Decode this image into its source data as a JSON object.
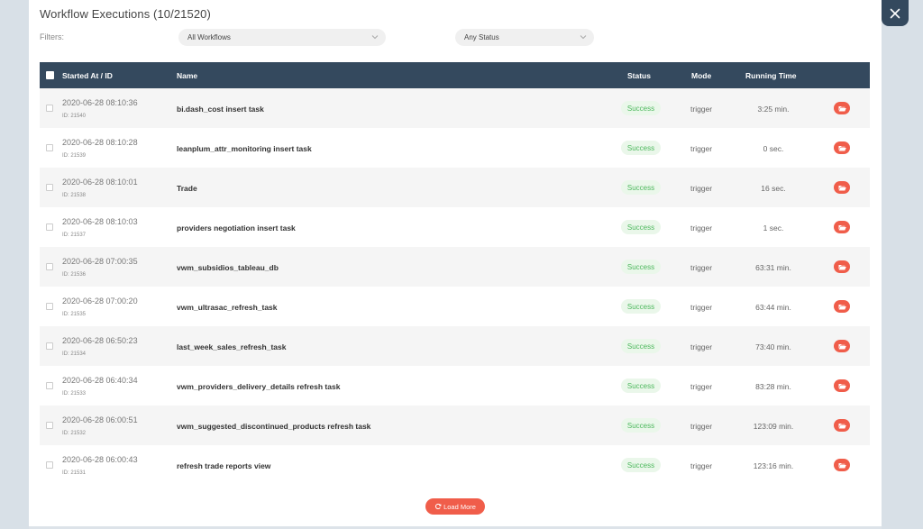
{
  "header": {
    "title": "Workflow Executions (10/21520)"
  },
  "filters": {
    "label": "Filters:",
    "workflow_selected": "All Workflows",
    "status_selected": "Any Status"
  },
  "table": {
    "columns": {
      "started": "Started At / ID",
      "name": "Name",
      "status": "Status",
      "mode": "Mode",
      "running": "Running Time"
    },
    "rows": [
      {
        "date": "2020-06-28 08:10:36",
        "id": "ID: 21540",
        "name": "bi.dash_cost insert task",
        "status": "Success",
        "mode": "trigger",
        "running": "3:25 min."
      },
      {
        "date": "2020-06-28 08:10:28",
        "id": "ID: 21539",
        "name": "leanplum_attr_monitoring insert task",
        "status": "Success",
        "mode": "trigger",
        "running": "0 sec."
      },
      {
        "date": "2020-06-28 08:10:01",
        "id": "ID: 21538",
        "name": "Trade",
        "status": "Success",
        "mode": "trigger",
        "running": "16 sec."
      },
      {
        "date": "2020-06-28 08:10:03",
        "id": "ID: 21537",
        "name": "providers negotiation insert task",
        "status": "Success",
        "mode": "trigger",
        "running": "1 sec."
      },
      {
        "date": "2020-06-28 07:00:35",
        "id": "ID: 21536",
        "name": "vwm_subsidios_tableau_db",
        "status": "Success",
        "mode": "trigger",
        "running": "63:31 min."
      },
      {
        "date": "2020-06-28 07:00:20",
        "id": "ID: 21535",
        "name": "vwm_ultrasac_refresh_task",
        "status": "Success",
        "mode": "trigger",
        "running": "63:44 min."
      },
      {
        "date": "2020-06-28 06:50:23",
        "id": "ID: 21534",
        "name": "last_week_sales_refresh_task",
        "status": "Success",
        "mode": "trigger",
        "running": "73:40 min."
      },
      {
        "date": "2020-06-28 06:40:34",
        "id": "ID: 21533",
        "name": "vwm_providers_delivery_details refresh task",
        "status": "Success",
        "mode": "trigger",
        "running": "83:28 min."
      },
      {
        "date": "2020-06-28 06:00:51",
        "id": "ID: 21532",
        "name": "vwm_suggested_discontinued_products refresh task",
        "status": "Success",
        "mode": "trigger",
        "running": "123:09 min."
      },
      {
        "date": "2020-06-28 06:00:43",
        "id": "ID: 21531",
        "name": "refresh trade reports view",
        "status": "Success",
        "mode": "trigger",
        "running": "123:16 min."
      }
    ]
  },
  "footer": {
    "load_more": "Load More"
  },
  "icons": {
    "close": "close-icon",
    "chevron": "chevron-down-icon",
    "open_folder": "folder-open-icon",
    "refresh": "refresh-icon"
  },
  "colors": {
    "header_bg": "#34495e",
    "accent": "#f05d4a",
    "success_text": "#4cb85c",
    "success_bg": "#eaf7ea"
  }
}
